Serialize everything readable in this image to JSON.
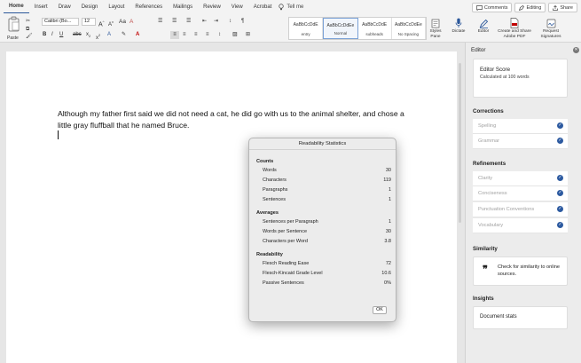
{
  "ribbon_tabs": [
    "Home",
    "Insert",
    "Draw",
    "Design",
    "Layout",
    "References",
    "Mailings",
    "Review",
    "View",
    "Acrobat"
  ],
  "tell_me": "Tell me",
  "top_right": {
    "comments": "Comments",
    "editing": "Editing",
    "share": "Share"
  },
  "ribbon": {
    "paste_label": "Paste",
    "font_name": "Calibri (Bo...",
    "font_size": "12",
    "styles": [
      {
        "sample": "AaBbCcDdE",
        "name": "entry"
      },
      {
        "sample": "AaBbCcDdEe",
        "name": "Normal"
      },
      {
        "sample": "AaBbCcDdE",
        "name": "subheads"
      },
      {
        "sample": "AaBbCcDdEe",
        "name": "No Spacing"
      }
    ],
    "buttons": [
      {
        "label": "Styles Pane"
      },
      {
        "label": "Dictate"
      },
      {
        "label": "Editor"
      },
      {
        "label": "Create and Share Adobe PDF"
      },
      {
        "label": "Request Signatures"
      }
    ]
  },
  "document": {
    "text": "Although my father first said we did not need a cat, he did go with us to the animal shelter, and chose a little gray fluffball that he named Bruce."
  },
  "dialog": {
    "title": "Readability Statistics",
    "counts_header": "Counts",
    "counts": [
      {
        "label": "Words",
        "value": "30"
      },
      {
        "label": "Characters",
        "value": "119"
      },
      {
        "label": "Paragraphs",
        "value": "1"
      },
      {
        "label": "Sentences",
        "value": "1"
      }
    ],
    "averages_header": "Averages",
    "averages": [
      {
        "label": "Sentences per Paragraph",
        "value": "1"
      },
      {
        "label": "Words per Sentence",
        "value": "30"
      },
      {
        "label": "Characters per Word",
        "value": "3.8"
      }
    ],
    "readability_header": "Readability",
    "readability": [
      {
        "label": "Flesch Reading Ease",
        "value": "72"
      },
      {
        "label": "Flesch-Kincaid Grade Level",
        "value": "10.6"
      },
      {
        "label": "Passive Sentences",
        "value": "0%"
      }
    ],
    "ok": "OK"
  },
  "editor_pane": {
    "title": "Editor",
    "score_title": "Editor Score",
    "score_sub": "Calculated at 100 words",
    "corrections_header": "Corrections",
    "corrections": [
      "Spelling",
      "Grammar"
    ],
    "refinements_header": "Refinements",
    "refinements": [
      "Clarity",
      "Conciseness",
      "Punctuation Conventions",
      "Vocabulary"
    ],
    "similarity_header": "Similarity",
    "similarity_text": "Check for similarity to online sources.",
    "insights_header": "Insights",
    "insights_text": "Document stats"
  },
  "colors": {
    "accent": "#2b579a",
    "check": "#2d5aa0"
  }
}
